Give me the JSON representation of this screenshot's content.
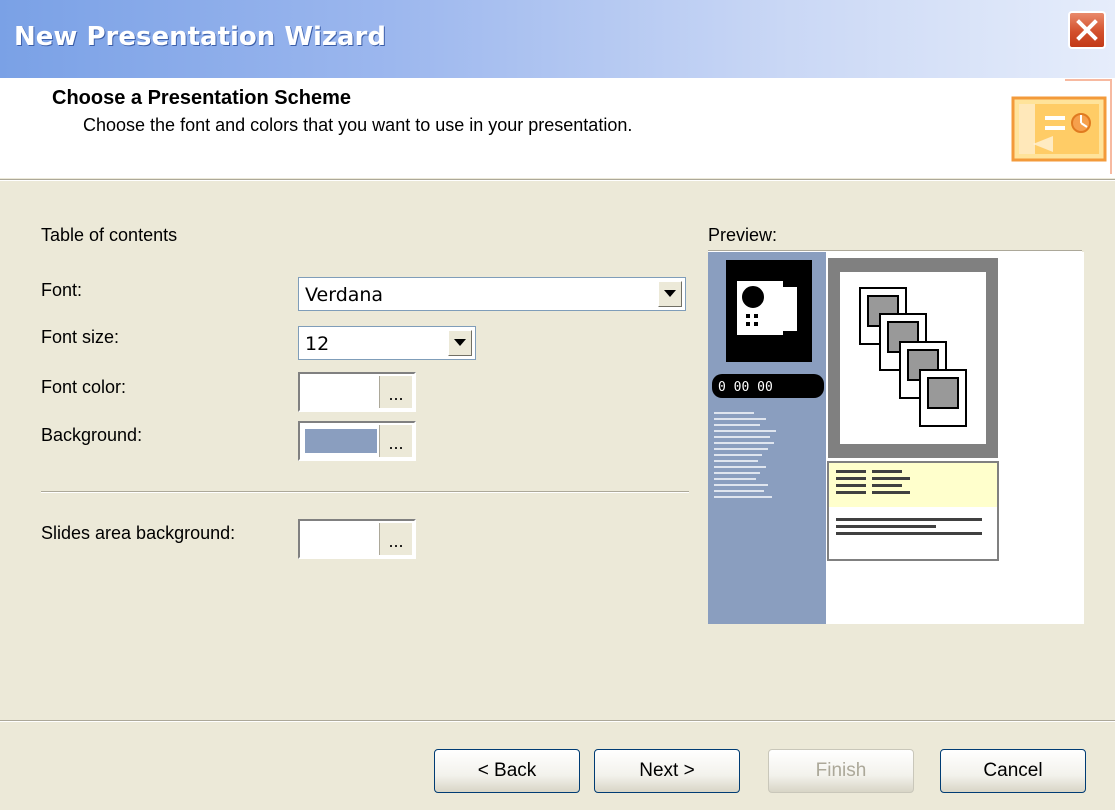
{
  "window": {
    "title": "New Presentation Wizard"
  },
  "header": {
    "title": "Choose a Presentation Scheme",
    "subtitle": "Choose the font and colors that you want to use in your presentation.",
    "icon": "presentation-scheme-icon"
  },
  "form": {
    "section_label": "Table of contents",
    "font": {
      "label": "Font:",
      "value": "Verdana"
    },
    "font_size": {
      "label": "Font size:",
      "value": "12"
    },
    "font_color": {
      "label": "Font color:",
      "button": "...",
      "color": "#ffffff"
    },
    "background": {
      "label": "Background:",
      "button": "...",
      "color": "#8a9ebf"
    },
    "slides_background": {
      "label": "Slides area background:",
      "button": "...",
      "color": "#ffffff"
    }
  },
  "preview": {
    "label": "Preview:",
    "counter": "0 00 00",
    "sidebar_color": "#8a9ebf"
  },
  "buttons": {
    "back": "< Back",
    "next": "Next >",
    "finish": "Finish",
    "cancel": "Cancel"
  }
}
